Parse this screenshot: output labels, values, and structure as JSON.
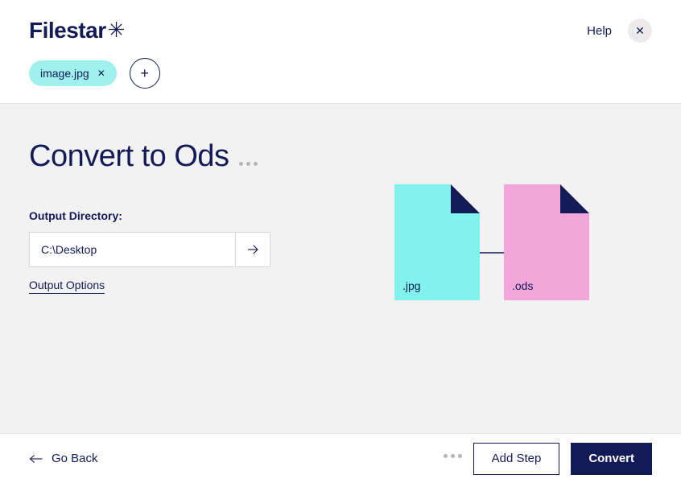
{
  "header": {
    "logo": "Filestar",
    "logo_star": "✳",
    "help": "Help"
  },
  "chips": {
    "file": "image.jpg"
  },
  "main": {
    "title": "Convert to Ods",
    "output_label": "Output Directory:",
    "output_value": "C:\\Desktop",
    "output_options": "Output Options"
  },
  "illustration": {
    "from_ext": ".jpg",
    "to_ext": ".ods"
  },
  "footer": {
    "go_back": "Go Back",
    "add_step": "Add Step",
    "convert": "Convert"
  }
}
